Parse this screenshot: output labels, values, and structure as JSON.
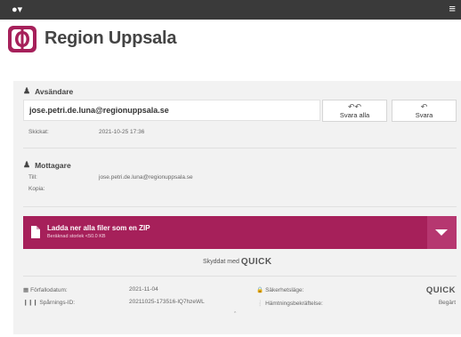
{
  "topbar": {
    "menu_icon": "globe-caret-icon",
    "hamburger_icon": "hamburger-icon"
  },
  "brand": {
    "name": "Region Uppsala",
    "logo_color": "#a6205a"
  },
  "sender": {
    "section_title": "Avsändare",
    "email": "jose.petri.de.luna@regionuppsala.se",
    "sent_label": "Skickat:",
    "sent_value": "2021-10-25 17:36"
  },
  "actions": {
    "reply_all": "Svara alla",
    "reply": "Svara"
  },
  "recipients": {
    "section_title": "Mottagare",
    "to_label": "Till:",
    "to_value": "jose.petri.de.luna@regionuppsala.se",
    "cc_label": "Kopia:",
    "cc_value": ""
  },
  "zip": {
    "title": "Ladda ner alla filer som en ZIP",
    "subtitle": "Beräknad storlek <50.0 KB",
    "bar_color": "#a6205a"
  },
  "protected": {
    "label": "Skyddat med",
    "brand": "QUICK"
  },
  "footer": {
    "expiry_label": "Förfallodatum:",
    "expiry_value": "2021-11-04",
    "tracking_label": "Spårnings-ID:",
    "tracking_value": "20211025-173516-lQ7hzeWL",
    "security_label": "Säkerhetsläge:",
    "security_value": "QUICK",
    "receipt_label": "Hämtningsbekräftelse:",
    "receipt_value": "Begärt"
  }
}
